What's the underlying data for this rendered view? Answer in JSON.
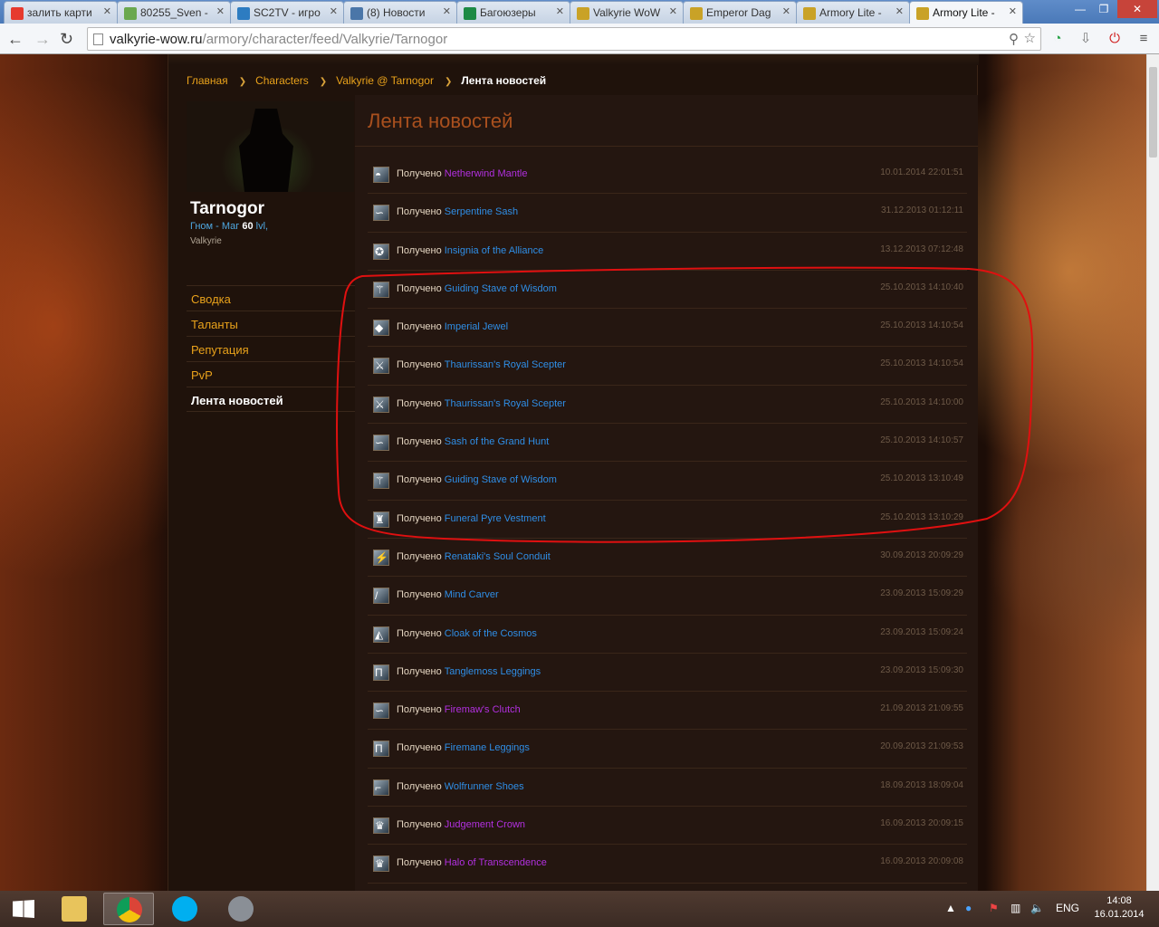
{
  "browser": {
    "tabs": [
      {
        "label": "залить карти",
        "color": "#e63a2e"
      },
      {
        "label": "80255_Sven -",
        "color": "#6aa84f"
      },
      {
        "label": "SC2TV - игро",
        "color": "#2d7cc1"
      },
      {
        "label": "(8) Новости",
        "color": "#4a76a8"
      },
      {
        "label": "Багоюзеры",
        "color": "#1d8a45"
      },
      {
        "label": "Valkyrie WoW",
        "color": "#c9a227"
      },
      {
        "label": "Emperor Dag",
        "color": "#c9a227"
      },
      {
        "label": "Armory Lite -",
        "color": "#c9a227"
      },
      {
        "label": "Armory Lite -",
        "color": "#c9a227",
        "active": true
      }
    ],
    "url_host": "valkyrie-wow.ru",
    "url_path": "/armory/character/feed/Valkyrie/Tarnogor"
  },
  "breadcrumb": {
    "home": "Главная",
    "characters": "Characters",
    "character": "Valkyrie @ Tarnogor",
    "current": "Лента новостей"
  },
  "character": {
    "name": "Tarnogor",
    "race_class": "Гном - Маг",
    "level": "60",
    "level_suffix": "lvl,",
    "realm": "Valkyrie"
  },
  "sidenav": [
    "Сводка",
    "Таланты",
    "Репутация",
    "PvP",
    "Лента новостей"
  ],
  "feed": {
    "title": "Лента новостей",
    "verb": "Получено",
    "items": [
      {
        "item": "Netherwind Mantle",
        "quality": "epic",
        "date": "10.01.2014 22:01:51",
        "icon": "shoulder-icon"
      },
      {
        "item": "Serpentine Sash",
        "quality": "rare",
        "date": "31.12.2013 01:12:11",
        "icon": "belt-icon"
      },
      {
        "item": "Insignia of the Alliance",
        "quality": "rare",
        "date": "13.12.2013 07:12:48",
        "icon": "trinket-icon"
      },
      {
        "item": "Guiding Stave of Wisdom",
        "quality": "rare",
        "date": "25.10.2013 14:10:40",
        "icon": "staff-icon"
      },
      {
        "item": "Imperial Jewel",
        "quality": "rare",
        "date": "25.10.2013 14:10:54",
        "icon": "jewel-icon"
      },
      {
        "item": "Thaurissan's Royal Scepter",
        "quality": "rare",
        "date": "25.10.2013 14:10:54",
        "icon": "scepter-icon"
      },
      {
        "item": "Thaurissan's Royal Scepter",
        "quality": "rare",
        "date": "25.10.2013 14:10:00",
        "icon": "scepter-icon"
      },
      {
        "item": "Sash of the Grand Hunt",
        "quality": "rare",
        "date": "25.10.2013 14:10:57",
        "icon": "belt-icon"
      },
      {
        "item": "Guiding Stave of Wisdom",
        "quality": "rare",
        "date": "25.10.2013 13:10:49",
        "icon": "staff-icon"
      },
      {
        "item": "Funeral Pyre Vestment",
        "quality": "rare",
        "date": "25.10.2013 13:10:29",
        "icon": "robe-icon"
      },
      {
        "item": "Renataki's Soul Conduit",
        "quality": "rare",
        "date": "30.09.2013 20:09:29",
        "icon": "wand-icon"
      },
      {
        "item": "Mind Carver",
        "quality": "rare",
        "date": "23.09.2013 15:09:29",
        "icon": "dagger-icon"
      },
      {
        "item": "Cloak of the Cosmos",
        "quality": "rare",
        "date": "23.09.2013 15:09:24",
        "icon": "cloak-icon"
      },
      {
        "item": "Tanglemoss Leggings",
        "quality": "rare",
        "date": "23.09.2013 15:09:30",
        "icon": "legs-icon"
      },
      {
        "item": "Firemaw's Clutch",
        "quality": "epic",
        "date": "21.09.2013 21:09:55",
        "icon": "belt-icon"
      },
      {
        "item": "Firemane Leggings",
        "quality": "rare",
        "date": "20.09.2013 21:09:53",
        "icon": "legs-icon"
      },
      {
        "item": "Wolfrunner Shoes",
        "quality": "rare",
        "date": "18.09.2013 18:09:04",
        "icon": "boots-icon"
      },
      {
        "item": "Judgement Crown",
        "quality": "epic",
        "date": "16.09.2013 20:09:15",
        "icon": "helm-icon"
      },
      {
        "item": "Halo of Transcendence",
        "quality": "epic",
        "date": "16.09.2013 20:09:08",
        "icon": "helm-icon"
      }
    ]
  },
  "colors": {
    "epic": "#b230e0",
    "rare": "#2f8ee6",
    "accent": "#e9a21b",
    "annotation": "#e01010"
  },
  "taskbar": {
    "lang": "ENG",
    "time": "14:08",
    "date": "16.01.2014"
  }
}
